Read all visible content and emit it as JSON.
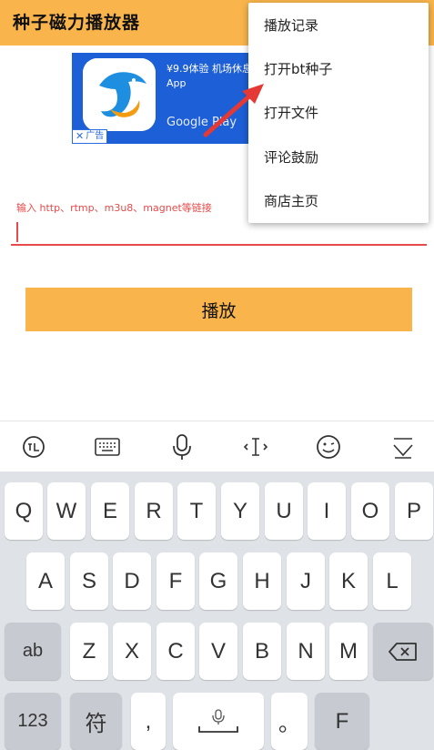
{
  "app": {
    "title": "种子磁力播放器"
  },
  "ad": {
    "text": "¥9.9体验 机场休息室 App",
    "store": "Google Play",
    "badge": "广告",
    "colors": {
      "background": "#1d5fd6"
    }
  },
  "input": {
    "hint": "输入 http、rtmp、m3u8、magnet等链接",
    "value": ""
  },
  "play_button": {
    "label": "播放"
  },
  "menu": {
    "items": [
      "播放记录",
      "打开bt种子",
      "打开文件",
      "评论鼓励",
      "商店主页"
    ]
  },
  "keyboard_toolbar": {
    "icons": [
      "xunfei-logo-icon",
      "keyboard-icon",
      "microphone-icon",
      "cursor-icon",
      "emoji-icon",
      "collapse-keyboard-icon"
    ]
  },
  "keyboard": {
    "row1": [
      "Q",
      "W",
      "E",
      "R",
      "T",
      "Y",
      "U",
      "I",
      "O",
      "P"
    ],
    "row2": [
      "A",
      "S",
      "D",
      "F",
      "G",
      "H",
      "J",
      "K",
      "L"
    ],
    "row3": {
      "left": "ab",
      "letters": [
        "Z",
        "X",
        "C",
        "V",
        "B",
        "N",
        "M"
      ]
    },
    "row4": {
      "num": "123",
      "sym": "符",
      "comma": ",",
      "period": "。",
      "last": "F"
    }
  },
  "colors": {
    "accent": "#f9b54b",
    "error": "#e64a4a",
    "arrow": "#e53935"
  }
}
